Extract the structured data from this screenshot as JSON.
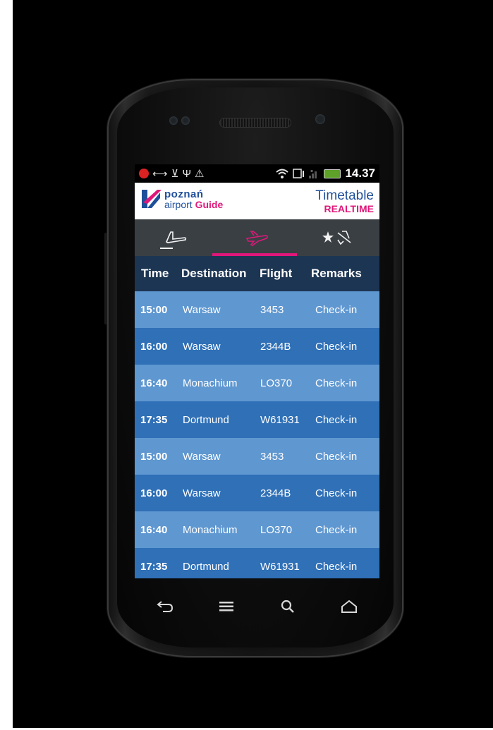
{
  "statusbar": {
    "time": "14.37",
    "icons": [
      "notification-icon",
      "usb-debug-icon",
      "download-icon",
      "usb-icon",
      "warning-icon",
      "wifi-icon",
      "sim-icon",
      "signal-icon",
      "battery-icon"
    ]
  },
  "header": {
    "logo_line1": "poznań",
    "logo_line2": "airport",
    "logo_guide": "Guide",
    "title": "Timetable",
    "subtitle": "REALTIME"
  },
  "tabs": [
    {
      "name": "arrivals",
      "icon": "plane-landing-icon",
      "active": false
    },
    {
      "name": "departures",
      "icon": "plane-takeoff-icon",
      "active": true
    },
    {
      "name": "favorites",
      "icon": "star-plane-icon",
      "active": false
    }
  ],
  "table": {
    "headers": {
      "time": "Time",
      "destination": "Destination",
      "flight": "Flight",
      "remarks": "Remarks"
    },
    "rows": [
      {
        "time": "15:00",
        "destination": "Warsaw",
        "flight": "3453",
        "remarks": "Check-in"
      },
      {
        "time": "16:00",
        "destination": "Warsaw",
        "flight": "2344B",
        "remarks": "Check-in"
      },
      {
        "time": "16:40",
        "destination": "Monachium",
        "flight": "LO370",
        "remarks": "Check-in"
      },
      {
        "time": "17:35",
        "destination": "Dortmund",
        "flight": "W61931",
        "remarks": "Check-in"
      },
      {
        "time": "15:00",
        "destination": "Warsaw",
        "flight": "3453",
        "remarks": "Check-in"
      },
      {
        "time": "16:00",
        "destination": "Warsaw",
        "flight": "2344B",
        "remarks": "Check-in"
      },
      {
        "time": "16:40",
        "destination": "Monachium",
        "flight": "LO370",
        "remarks": "Check-in"
      },
      {
        "time": "17:35",
        "destination": "Dortmund",
        "flight": "W61931",
        "remarks": "Check-in"
      }
    ]
  },
  "navbar": [
    "back-icon",
    "menu-icon",
    "search-icon",
    "home-icon"
  ],
  "colors": {
    "brand_blue": "#1f4f9a",
    "brand_pink": "#e0177a",
    "row_light": "#5f97d0",
    "row_dark": "#2f70b7",
    "table_header": "#1c3553",
    "tab_bar": "#3a3f44"
  }
}
